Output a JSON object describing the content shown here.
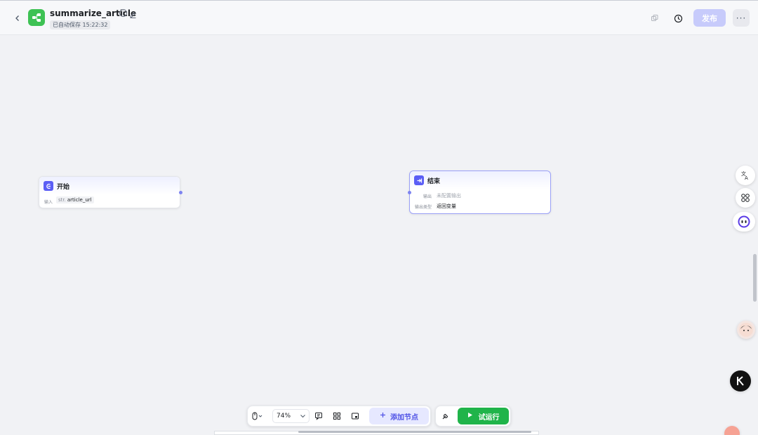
{
  "header": {
    "title": "summarize_article",
    "autosave": "已自动保存 15:22:32",
    "publish_label": "发布",
    "more_label": "···",
    "back_icon": "chevron-left-icon",
    "logo_icon": "workflow-logo-icon",
    "logo_color": "#3ec254"
  },
  "nodes": {
    "start": {
      "title": "开始",
      "input_label": "输入",
      "input_type": "str.",
      "input_value": "article_url"
    },
    "end": {
      "title": "结束",
      "output_label": "输出",
      "output_value": "未配置输出",
      "output_type_label": "输出类型",
      "output_type_value": "返回变量"
    }
  },
  "toolbar": {
    "zoom": "74%",
    "add_node_label": "添加节点",
    "run_label": "试运行"
  },
  "colors": {
    "accent": "#5b5ef5",
    "run_green": "#20b44a",
    "publish_disabled": "#c7cbfb"
  }
}
